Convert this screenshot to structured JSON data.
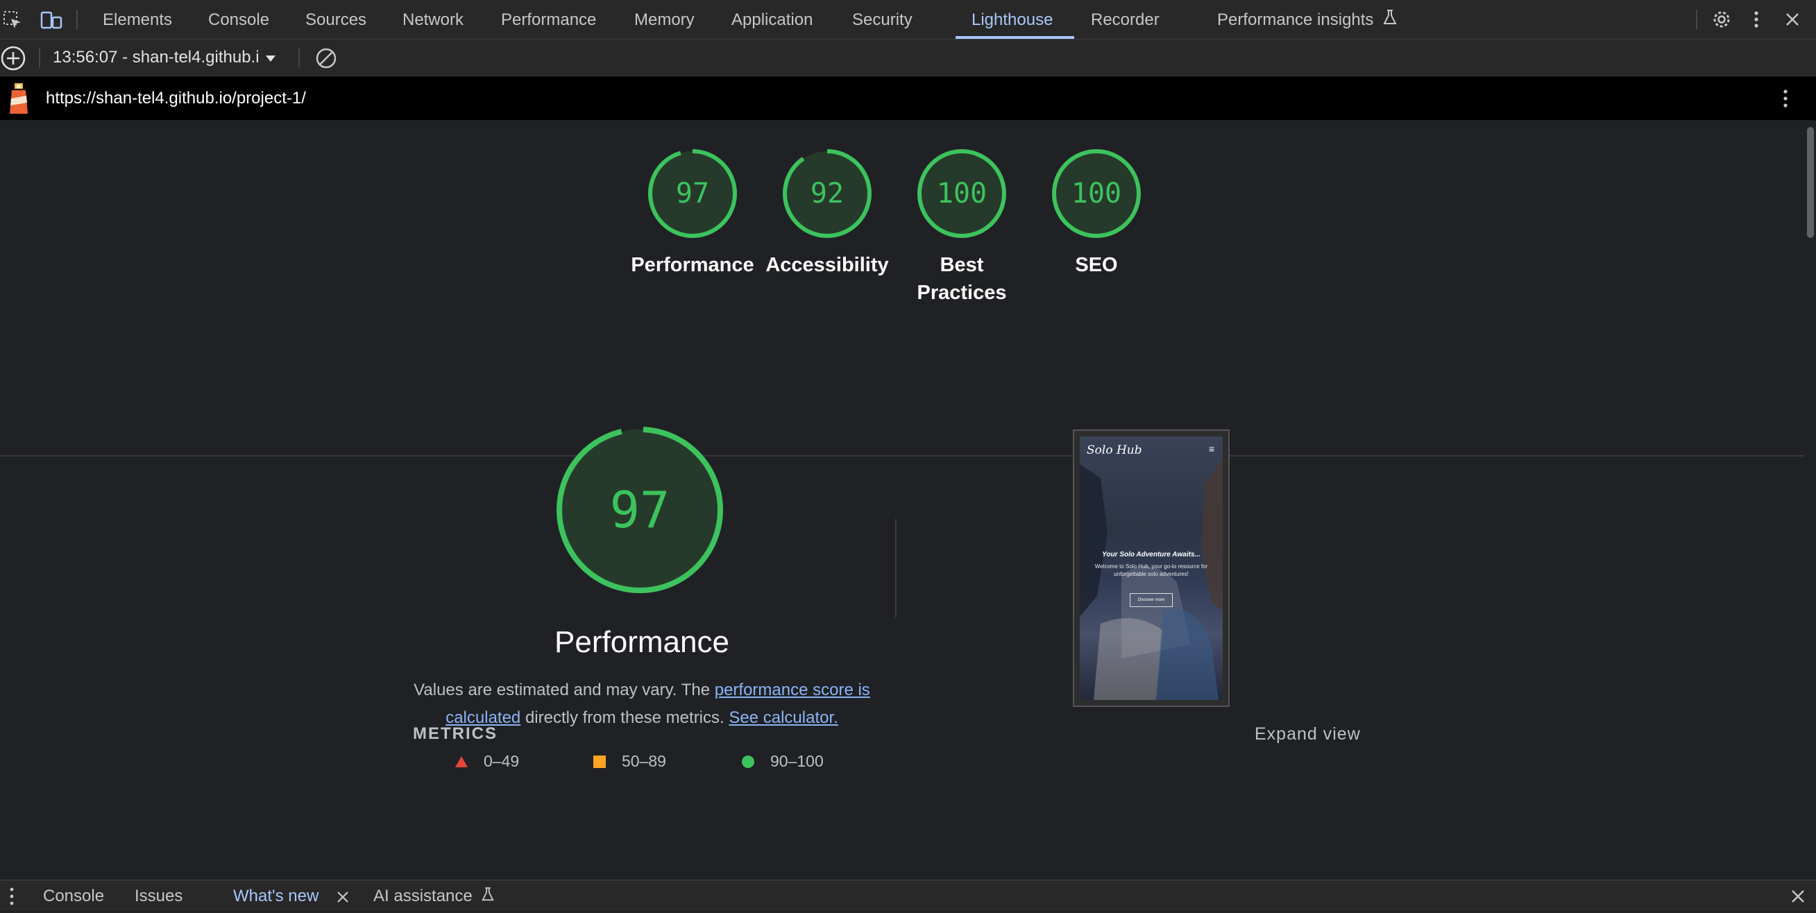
{
  "devtools_tabs": [
    {
      "label": "Elements"
    },
    {
      "label": "Console"
    },
    {
      "label": "Sources"
    },
    {
      "label": "Network"
    },
    {
      "label": "Performance"
    },
    {
      "label": "Memory"
    },
    {
      "label": "Application"
    },
    {
      "label": "Security"
    },
    {
      "label": "Lighthouse"
    },
    {
      "label": "Recorder"
    },
    {
      "label": "Performance insights"
    }
  ],
  "active_tab": "Lighthouse",
  "toolbar": {
    "report_select": "13:56:07 - shan-tel4.github.i"
  },
  "url_bar": {
    "url": "https://shan-tel4.github.io/project-1/"
  },
  "summary_scores": [
    {
      "score": "97",
      "label": "Performance",
      "fraction": 0.97
    },
    {
      "score": "92",
      "label": "Accessibility",
      "fraction": 0.92
    },
    {
      "score": "100",
      "label": "Best Practices",
      "fraction": 1.0
    },
    {
      "score": "100",
      "label": "SEO",
      "fraction": 1.0
    }
  ],
  "performance": {
    "score": "97",
    "fraction": 0.97,
    "title": "Performance",
    "desc_prefix": "Values are estimated and may vary. The ",
    "desc_link1": "performance score is calculated",
    "desc_middle": " directly from these metrics. ",
    "desc_link2": "See calculator."
  },
  "legend": [
    {
      "range": "0–49",
      "shape": "triangle",
      "color": "#e8453c"
    },
    {
      "range": "50–89",
      "shape": "square",
      "color": "#ffa424"
    },
    {
      "range": "90–100",
      "shape": "circle",
      "color": "#3cc35d"
    }
  ],
  "thumbnail": {
    "brand": "Solo Hub",
    "headline": "Your Solo Adventure Awaits...",
    "subtext": "Welcome to Solo Hub, your go-to resource for unforgettable solo adventures!",
    "button": "Discover more"
  },
  "metrics_heading": "METRICS",
  "expand_view": "Expand view",
  "drawer_tabs": [
    {
      "label": "Console"
    },
    {
      "label": "Issues"
    },
    {
      "label": "What's new"
    },
    {
      "label": "AI assistance"
    }
  ],
  "colors": {
    "pass": "#3cc35d",
    "accent": "#a8c7fa",
    "link": "#8ab4f8"
  }
}
